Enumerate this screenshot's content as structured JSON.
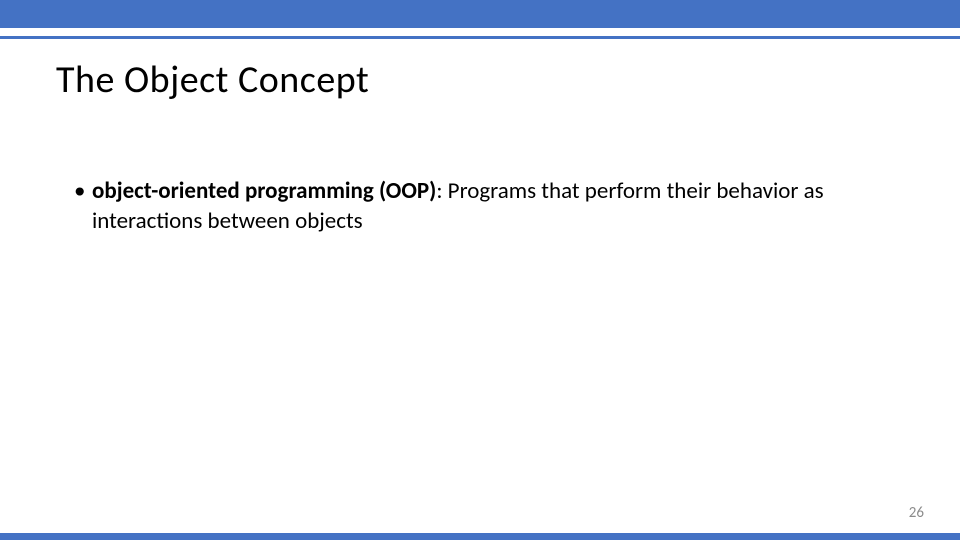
{
  "colors": {
    "accent": "#4472c4"
  },
  "slide": {
    "title": "The Object Concept",
    "bullet": {
      "bold_term": "object-oriented programming (OOP)",
      "rest": ": Programs that perform their behavior as interactions between objects"
    },
    "page_number": "26"
  }
}
